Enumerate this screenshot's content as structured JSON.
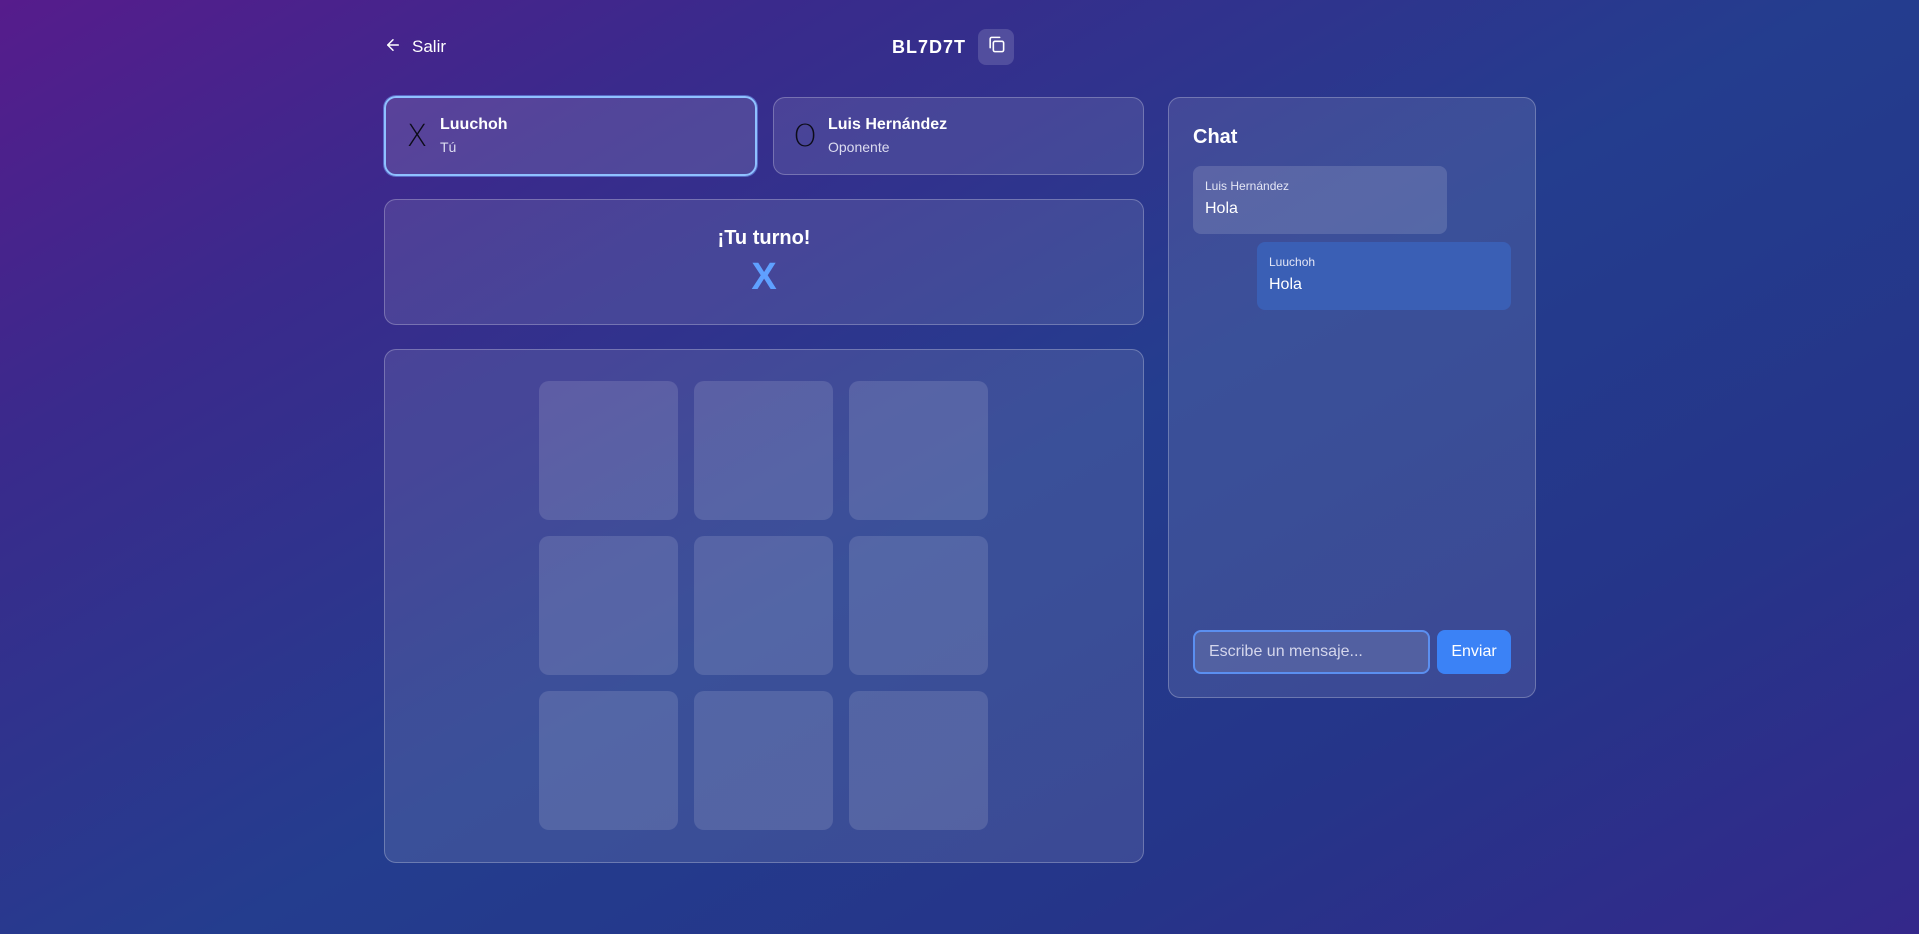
{
  "header": {
    "back_label": "Salir",
    "back_icon": "arrow-left-icon",
    "room_code": "BL7D7T",
    "copy_icon": "copy-icon"
  },
  "players": [
    {
      "symbol": "X",
      "name": "Luuchoh",
      "role": "Tú",
      "active": true
    },
    {
      "symbol": "O",
      "name": "Luis Hernández",
      "role": "Oponente",
      "active": false
    }
  ],
  "turn": {
    "title": "¡Tu turno!",
    "symbol": "X",
    "symbol_color": "#5fa0ff"
  },
  "board": {
    "cells": [
      "",
      "",
      "",
      "",
      "",
      "",
      "",
      "",
      ""
    ]
  },
  "chat": {
    "title": "Chat",
    "messages": [
      {
        "author": "Luis Hernández",
        "text": "Hola",
        "mine": false
      },
      {
        "author": "Luuchoh",
        "text": "Hola",
        "mine": true
      }
    ],
    "input_placeholder": "Escribe un mensaje...",
    "input_value": "",
    "send_label": "Enviar"
  },
  "colors": {
    "accent": "#3b82f6",
    "active_border": "#8fc1ff"
  }
}
